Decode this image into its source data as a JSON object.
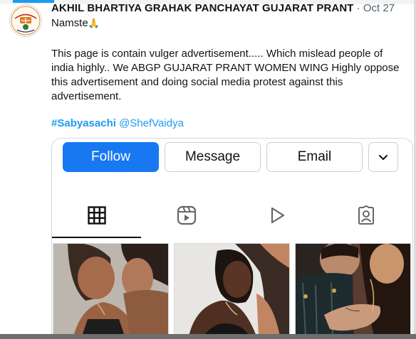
{
  "tweet": {
    "author": "AKHIL BHARTIYA GRAHAK PANCHAYAT GUJARAT PRANT",
    "separator": "·",
    "date": "Oct 27",
    "greeting": "Namste",
    "body": "This page is contain vulger advertisement..... Which mislead people of india highly.. We ABGP GUJARAT PRANT WOMEN WING Highly oppose this advertisement and doing social media protest against this advertisement.",
    "hashtag": "#Sabyasachi",
    "mention": "@ShefVaidya"
  },
  "profile_card": {
    "buttons": {
      "follow": "Follow",
      "message": "Message",
      "email": "Email"
    },
    "icons": [
      "grid-icon",
      "reels-icon",
      "video-play-icon",
      "tagged-icon",
      "chevron-down-icon",
      "folded-hands-icon"
    ],
    "colors": {
      "follow_button": "#1778f2",
      "link": "#1d9bf0"
    }
  }
}
